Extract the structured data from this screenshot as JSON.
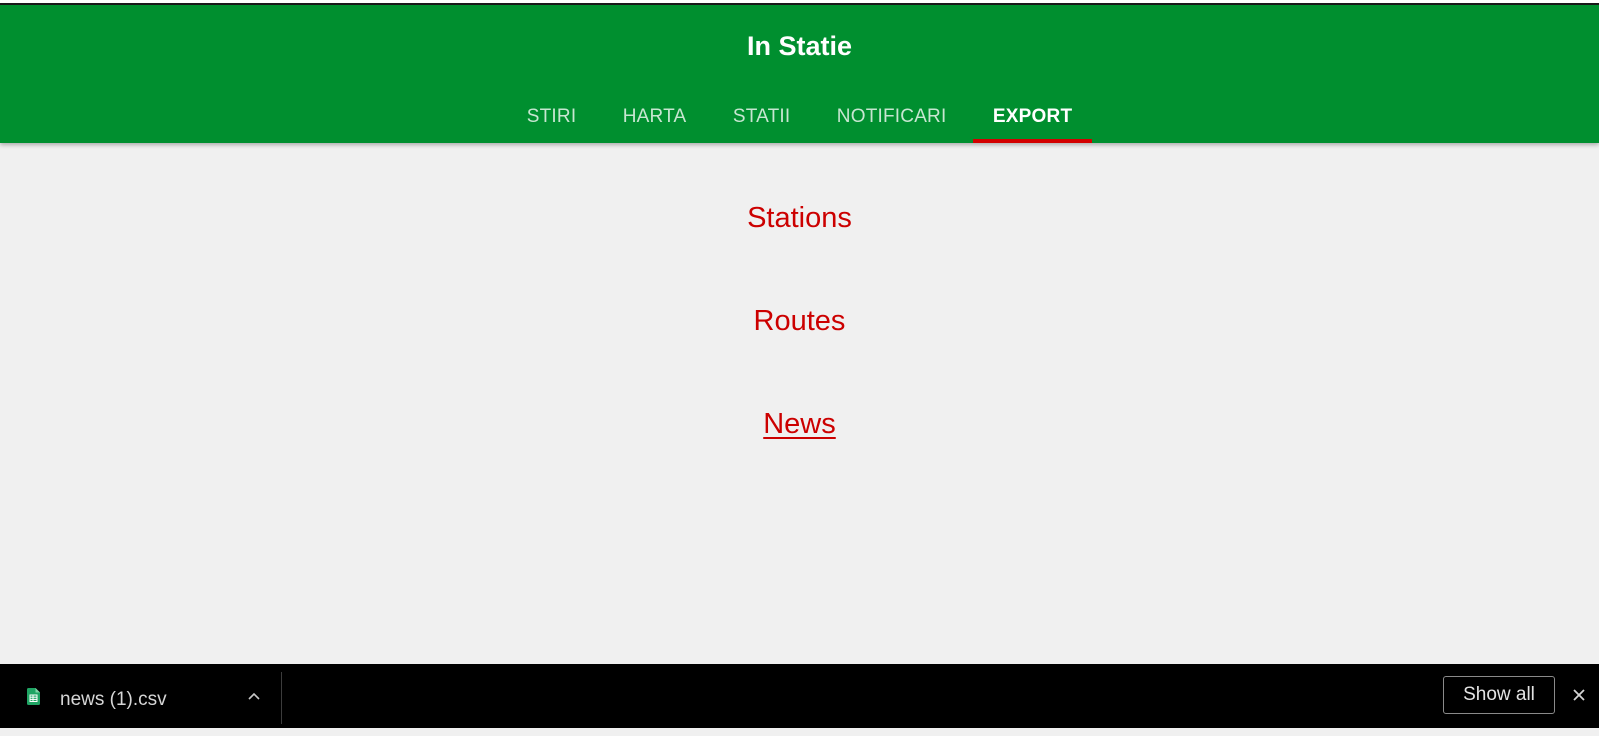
{
  "app": {
    "title": "In Statie"
  },
  "tabs": [
    {
      "label": "STIRI",
      "active": false
    },
    {
      "label": "HARTA",
      "active": false
    },
    {
      "label": "STATII",
      "active": false
    },
    {
      "label": "NOTIFICARI",
      "active": false
    },
    {
      "label": "EXPORT",
      "active": true
    }
  ],
  "export_links": {
    "stations": "Stations",
    "routes": "Routes",
    "news": "News"
  },
  "download_bar": {
    "file_name": "news (1).csv",
    "file_icon": "spreadsheet-file-icon",
    "expand_icon": "chevron-up-icon",
    "show_all_label": "Show all",
    "close_icon": "close-icon"
  },
  "colors": {
    "appbar": "#008f2f",
    "tab_indicator": "#d30000",
    "link": "#cc0000",
    "page_background": "#f0f0f0",
    "download_bar": "#000000"
  }
}
